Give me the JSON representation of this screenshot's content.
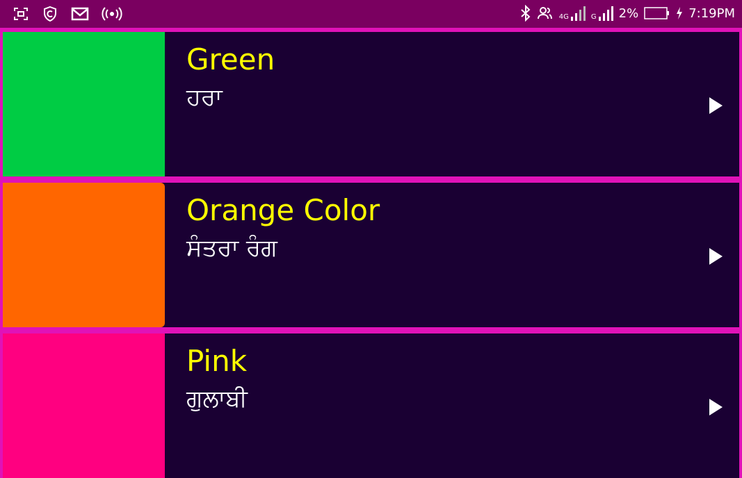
{
  "status_bar": {
    "left_icons": [
      "screenshot-icon",
      "shield-icon",
      "gmail-icon",
      "hotspot-icon"
    ],
    "right_icons": [
      "bluetooth-icon",
      "contacts-icon",
      "signal-4g-icon",
      "signal-g-icon",
      "battery-icon",
      "charging-icon"
    ],
    "network_4g": "4G",
    "network_g": "G",
    "battery": "2%",
    "time": "7:19PM"
  },
  "colors": [
    {
      "english": "Green",
      "punjabi": "ਹਰਾ",
      "swatch": "#00cc44"
    },
    {
      "english": "Orange Color",
      "punjabi": "ਸੰਤਰਾ ਰੰਗ",
      "swatch": "#ff6600"
    },
    {
      "english": "Pink",
      "punjabi": "ਗੁਲਾਬੀ",
      "swatch": "#ff0080"
    }
  ]
}
